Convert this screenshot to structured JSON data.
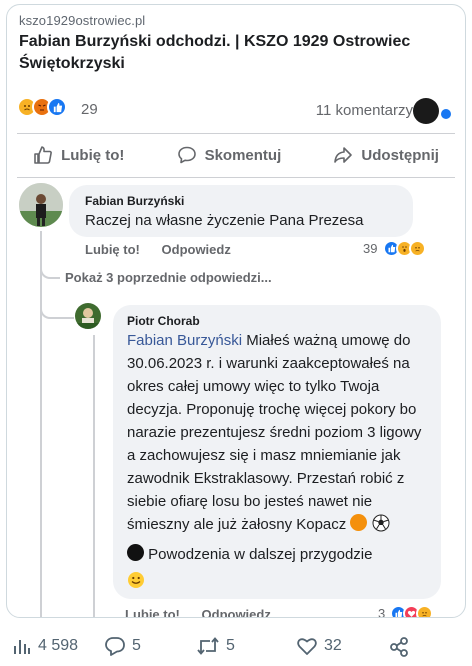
{
  "link": {
    "domain": "kszo1929ostrowiec.pl",
    "title": "Fabian Burzyński odchodzi. | KSZO 1929 Ostrowiec Świętokrzyski"
  },
  "reactions": {
    "count": "29",
    "comments": "11 komentarzy",
    "icons": [
      "sad-emoji",
      "angry-emoji",
      "like-thumb"
    ]
  },
  "actions": {
    "like": "Lubię to!",
    "comment": "Skomentuj",
    "share": "Udostępnij"
  },
  "comment1": {
    "author": "Fabian Burzyński",
    "text": "Raczej na własne życzenie Pana Prezesa",
    "like": "Lubię to!",
    "reply": "Odpowiedz",
    "reaction_count": "39"
  },
  "show_more": "Pokaż 3 poprzednie odpowiedzi...",
  "comment2": {
    "author": "Piotr Chorab",
    "mention": "Fabian Burzyński",
    "text": "Miałeś ważną umowę do 30.06.2023 r. i warunki zaakceptowałeś na okres całej umowy więc to tylko Twoja decyzja. Proponuję trochę więcej pokory bo narazie prezentujesz średni poziom 3 ligowy a zachowujesz się i masz mniemianie jak zawodnik Ekstraklasowy. Przestań robić z siebie ofiarę losu bo jesteś nawet nie śmieszny ale już żałosny Kopacz",
    "text2": "Powodzenia w dalszej przygodzie",
    "like": "Lubię to!",
    "reply": "Odpowiedz",
    "reaction_count": "3"
  },
  "stats": {
    "views": "4 598",
    "replies": "5",
    "reposts": "5",
    "likes": "32"
  },
  "colors": {
    "mention": "#385898",
    "bubble": "#f0f2f5",
    "fb_blue": "#1877f2",
    "muted": "#65676b"
  }
}
